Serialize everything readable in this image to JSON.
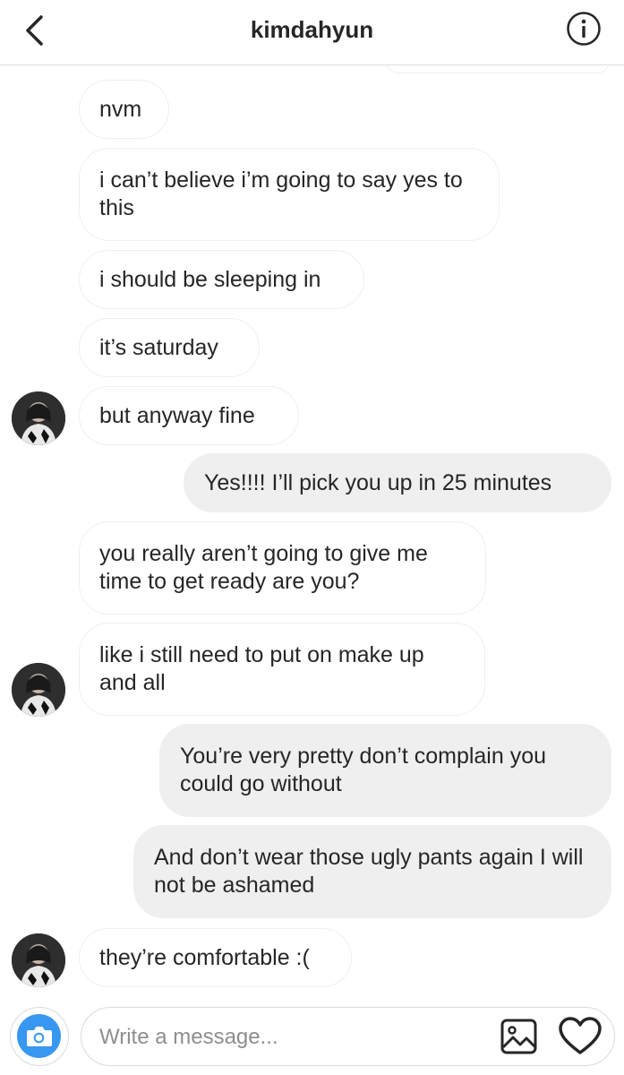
{
  "header": {
    "title": "kimdahyun",
    "back_icon": "chevron-left-icon",
    "info_icon": "info-icon"
  },
  "messages": [
    {
      "sender": "them",
      "text": "nvm"
    },
    {
      "sender": "them",
      "text": "i can’t believe i’m going to say yes to this"
    },
    {
      "sender": "them",
      "text": "i should be sleeping in"
    },
    {
      "sender": "them",
      "text": "it’s saturday"
    },
    {
      "sender": "them",
      "text": "but anyway fine",
      "avatar": true
    },
    {
      "sender": "me",
      "text": "Yes!!!! I’ll pick you up in 25 minutes"
    },
    {
      "sender": "them",
      "text": "you really aren’t going to give me time to get ready are you?"
    },
    {
      "sender": "them",
      "text": "like i still need to put on make up and all",
      "avatar": true
    },
    {
      "sender": "me",
      "text": "You’re very pretty don’t complain you could go without"
    },
    {
      "sender": "me",
      "text": "And don’t wear those ugly pants again I will not be ashamed"
    },
    {
      "sender": "them",
      "text": "they’re comfortable :(",
      "avatar": true
    }
  ],
  "composer": {
    "placeholder": "Write a message...",
    "camera_icon": "camera-icon",
    "gallery_icon": "gallery-icon",
    "heart_icon": "heart-icon"
  },
  "colors": {
    "accent": "#3897f0",
    "outgoing_bubble": "#efefef",
    "incoming_border": "#efefef",
    "text": "#262626",
    "placeholder": "#8e8e8e"
  }
}
